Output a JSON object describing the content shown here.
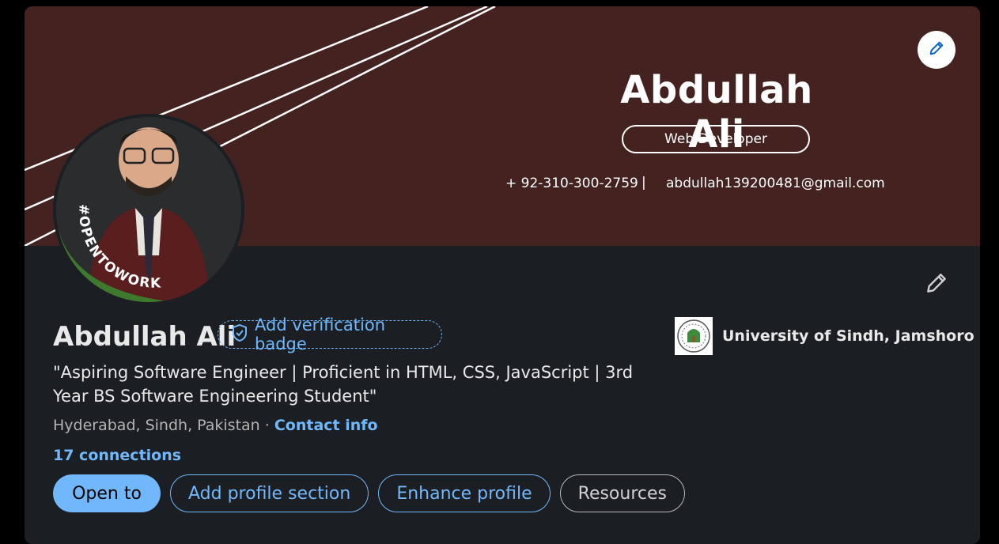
{
  "banner": {
    "name": "Abdullah Ali",
    "role": "Web Developer",
    "phone": "+ 92-310-300-2759",
    "separator": "|",
    "email": "abdullah139200481@gmail.com"
  },
  "avatar": {
    "badge_text": "#OPENTOWORK"
  },
  "profile": {
    "name": "Abdullah Ali",
    "verification_label": "Add verification badge",
    "headline": "\"Aspiring Software Engineer | Proficient in HTML, CSS, JavaScript | 3rd Year BS Software Engineering Student\"",
    "location": "Hyderabad, Sindh, Pakistan",
    "location_sep": " · ",
    "contact_label": "Contact info",
    "connections": "17 connections"
  },
  "education": {
    "name": "University of Sindh, Jamshoro"
  },
  "actions": {
    "open_to": "Open to",
    "add_section": "Add profile section",
    "enhance": "Enhance profile",
    "resources": "Resources"
  },
  "colors": {
    "banner_bg": "#442220",
    "card_bg": "#1b1f23",
    "accent": "#71b7fb",
    "open_to_work_green": "#3e7a2d"
  },
  "icons": {
    "edit_banner": "pencil-icon",
    "edit_intro": "pencil-icon",
    "verification": "shield-check-icon"
  }
}
